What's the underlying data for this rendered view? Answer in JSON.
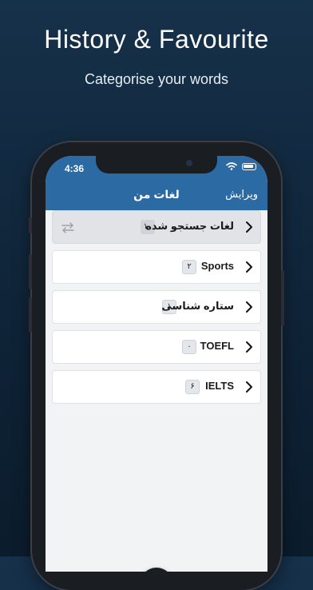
{
  "promo": {
    "headline": "History & Favourite",
    "subline": "Categorise your words"
  },
  "status_bar": {
    "time": "4:36"
  },
  "nav": {
    "title": "لغات من",
    "edit_label": "ویرایش"
  },
  "lists": [
    {
      "label": "لغات جستجو شده",
      "count": "۱۰"
    },
    {
      "label": "Sports",
      "count": "۲"
    },
    {
      "label": "ستاره شناسی",
      "count": "۱"
    },
    {
      "label": "TOEFL",
      "count": "۰"
    },
    {
      "label": "IELTS",
      "count": "۶"
    }
  ],
  "colors": {
    "background": "#16314a",
    "nav_bar": "#2c6aa4",
    "selected_row": "#e1e3e7",
    "fab": "#1a1d21"
  },
  "icons": {
    "row_chevron": "chevron-right-icon",
    "swap": "swap-arrows-icon",
    "add": "plus-icon"
  }
}
